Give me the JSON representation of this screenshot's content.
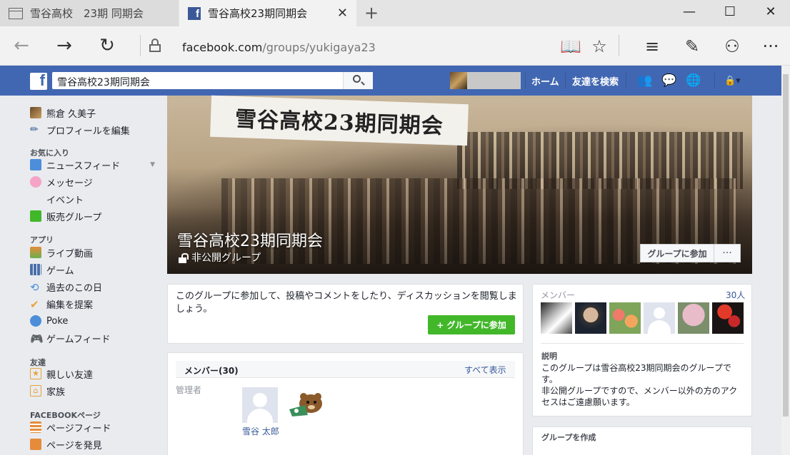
{
  "browser": {
    "tab1_title": "雪谷高校　23期 同期会",
    "tab2_title": "雪谷高校23期同期会",
    "url_host": "facebook.com",
    "url_path": "/groups/yukigaya23"
  },
  "fb": {
    "logo": "f",
    "search_value": "雪谷高校23期同期会",
    "nav_home": "ホーム",
    "nav_find_friends": "友達を検索"
  },
  "sidebar": {
    "user_name": "熊倉 久美子",
    "edit_profile": "プロフィールを編集",
    "favorites_head": "お気に入り",
    "favorites": [
      "ニュースフィード",
      "メッセージ",
      "イベント",
      "販売グループ"
    ],
    "apps_head": "アプリ",
    "apps": [
      "ライブ動画",
      "ゲーム",
      "過去のこの日",
      "編集を提案",
      "Poke",
      "ゲームフィード"
    ],
    "friends_head": "友達",
    "friends": [
      "親しい友達",
      "家族"
    ],
    "pages_head": "FACEBOOKページ",
    "pages": [
      "ページフィード",
      "ページを発見"
    ]
  },
  "cover": {
    "banner_text": "雪谷高校23期同期会",
    "title": "雪谷高校23期同期会",
    "privacy": "非公開グループ",
    "join_button": "グループに参加",
    "more_button": "···"
  },
  "join_card": {
    "message": "このグループに参加して、投稿やコメントをしたり、ディスカッションを閲覧しましょう。",
    "button": "+ グループに参加"
  },
  "members_card": {
    "title": "メンバー(30)",
    "see_all": "すべて表示",
    "admin_label": "管理者",
    "admin_name": "雪谷 太郎"
  },
  "side": {
    "members_label": "メンバー",
    "members_count": "30人",
    "desc_label": "説明",
    "desc_text": "このグループは雪谷高校23期同期会のグループです。\n非公開グループですので、メンバー以外の方のアクセスはご遠慮願います。",
    "create_label": "グループを作成"
  }
}
